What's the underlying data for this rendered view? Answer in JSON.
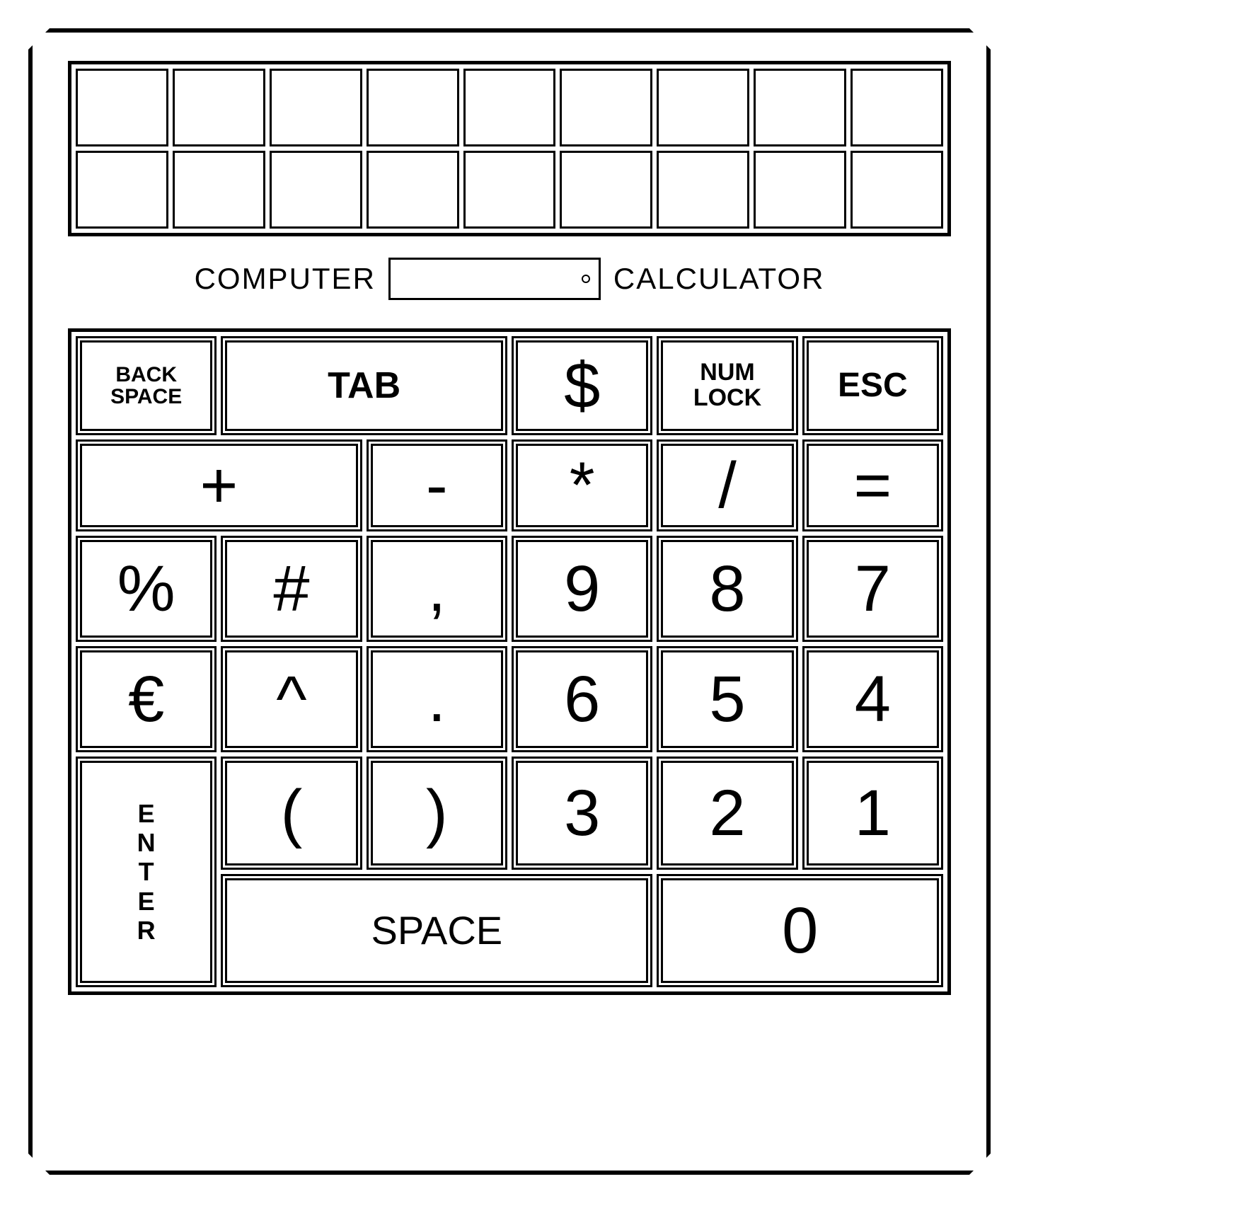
{
  "mode": {
    "left_label": "COMPUTER",
    "right_label": "CALCULATOR"
  },
  "keys": {
    "backspace_line1": "BACK",
    "backspace_line2": "SPACE",
    "tab": "TAB",
    "dollar": "$",
    "numlock_line1": "NUM",
    "numlock_line2": "LOCK",
    "esc": "ESC",
    "plus": "+",
    "minus": "-",
    "star": "*",
    "slash": "/",
    "equals": "=",
    "percent": "%",
    "hash": "#",
    "comma": ",",
    "nine": "9",
    "eight": "8",
    "seven": "7",
    "euro": "€",
    "caret": "^",
    "dot": ".",
    "six": "6",
    "five": "5",
    "four": "4",
    "enter_c1": "E",
    "enter_c2": "N",
    "enter_c3": "T",
    "enter_c4": "E",
    "enter_c5": "R",
    "lparen": "(",
    "rparen": ")",
    "three": "3",
    "two": "2",
    "one": "1",
    "space": "SPACE",
    "zero": "0"
  }
}
